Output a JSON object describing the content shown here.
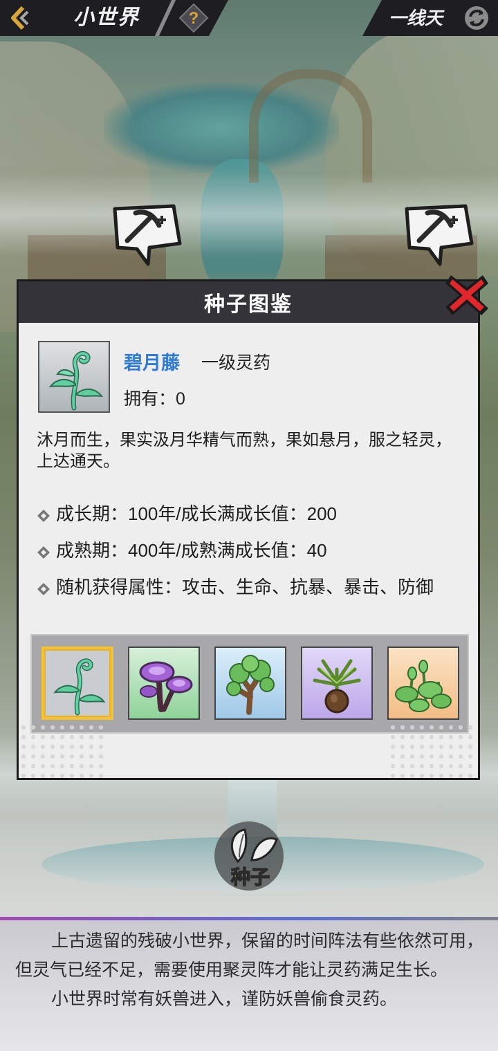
{
  "header": {
    "title": "小世界",
    "location": "一线天",
    "help_label": "?"
  },
  "modal": {
    "title": "种子图鉴",
    "item": {
      "name": "碧月藤",
      "grade": "一级灵药",
      "owned_label": "拥有：",
      "owned_value": "0",
      "description": "沐月而生，果实汲月华精气而熟，果如悬月，服之轻灵，上达通天。"
    },
    "stats": [
      "成长期：100年/成长满成长值：200",
      "成熟期：400年/成熟满成长值：40",
      "随机获得属性：攻击、生命、抗暴、暴击、防御"
    ],
    "seeds": [
      {
        "icon": "vine-sprout-icon",
        "bg": "#c9ccd0",
        "selected": true
      },
      {
        "icon": "purple-mushroom-icon",
        "bg": "#9fd9a6",
        "selected": false
      },
      {
        "icon": "tree-icon",
        "bg": "#a9cde8",
        "selected": false
      },
      {
        "icon": "palm-bulb-icon",
        "bg": "#c7b6ec",
        "selected": false
      },
      {
        "icon": "lotus-leaves-icon",
        "bg": "#f3c99b",
        "selected": false
      }
    ]
  },
  "seed_button": {
    "label": "种子"
  },
  "footer": {
    "paragraphs": [
      "上古遗留的残破小世界，保留的时间阵法有些依然可用，但灵气已经不足，需要使用聚灵阵才能让灵药满足生长。",
      "小世界时常有妖兽进入，谨防妖兽偷食灵药。"
    ]
  },
  "colors": {
    "item_name": "#2f7ad2",
    "header_bg": "#35343b",
    "selected_border": "#f2c230",
    "close_red": "#e0282c"
  }
}
